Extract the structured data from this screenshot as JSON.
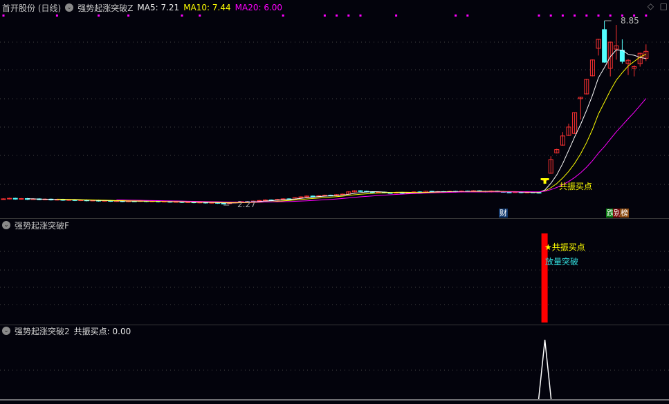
{
  "header": {
    "stock": "首开股份 (日线)",
    "indicator": "强势起涨突破Z",
    "ma5_label": "MA5: 7.21",
    "ma10_label": "MA10: 7.44",
    "ma20_label": "MA20: 6.00"
  },
  "colors": {
    "up": "#ff3232",
    "down": "#54ffff",
    "ma5": "#ffffff",
    "ma10": "#ffff00",
    "ma20": "#ff00ff",
    "signal": "#ff00ff"
  },
  "main": {
    "high_label": "8.85",
    "low_label": "2.27",
    "buy_label": "共振买点",
    "badges": {
      "finance": "财",
      "tag1": "跌",
      "tag2": "别",
      "tag3": "榜"
    }
  },
  "panel2": {
    "title": "强势起涨突破F",
    "star_label": "★共振买点",
    "vol_label": "放量突破"
  },
  "panel3": {
    "title": "强势起涨突破2",
    "value_label": "共振买点: 0.00"
  },
  "top_icons": {
    "diamond": "◇",
    "box": "□"
  },
  "chart_data": {
    "type": "candlestick",
    "price_range": [
      2.0,
      9.0
    ],
    "flat_closes": [
      2.45,
      2.47,
      2.44,
      2.46,
      2.43,
      2.45,
      2.42,
      2.44,
      2.41,
      2.43,
      2.4,
      2.42,
      2.39,
      2.41,
      2.38,
      2.4,
      2.37,
      2.39,
      2.36,
      2.38,
      2.35,
      2.37,
      2.36,
      2.38,
      2.35,
      2.37,
      2.34,
      2.36,
      2.33,
      2.35,
      2.32,
      2.34,
      2.31,
      2.33,
      2.3,
      2.32,
      2.29,
      2.28,
      2.31,
      2.33,
      2.35,
      2.34,
      2.37,
      2.39,
      2.41,
      2.4,
      2.43,
      2.45,
      2.44,
      2.5,
      2.52,
      2.55,
      2.53,
      2.56,
      2.58,
      2.57,
      2.6,
      2.62,
      2.7,
      2.74,
      2.72,
      2.7,
      2.68,
      2.69,
      2.67,
      2.66,
      2.68,
      2.65,
      2.67,
      2.7,
      2.68,
      2.72,
      2.7,
      2.71,
      2.69,
      2.72,
      2.7,
      2.73,
      2.71,
      2.74,
      2.72,
      2.7,
      2.73,
      2.71,
      2.69,
      2.68,
      2.7,
      2.67,
      2.69,
      2.68,
      2.66
    ],
    "rally_ohlc": [
      [
        3.12,
        3.14,
        3.16,
        3.1
      ],
      [
        3.37,
        3.86,
        3.98,
        3.35
      ],
      [
        4.1,
        4.22,
        4.25,
        4.08
      ],
      [
        4.38,
        4.71,
        4.85,
        4.36
      ],
      [
        4.73,
        5.03,
        5.15,
        4.71
      ],
      [
        4.8,
        5.55,
        5.56,
        4.78
      ],
      [
        6.05,
        6.1,
        6.12,
        5.3
      ],
      [
        6.22,
        6.74,
        6.76,
        6.2
      ],
      [
        6.87,
        7.44,
        7.46,
        6.85
      ],
      [
        7.86,
        8.18,
        8.2,
        7.6
      ],
      [
        8.53,
        7.36,
        8.85,
        7.34
      ],
      [
        7.14,
        8.08,
        8.1,
        6.85
      ],
      [
        7.83,
        7.95,
        8.7,
        7.45
      ],
      [
        7.79,
        7.39,
        8.18,
        7.31
      ],
      [
        7.31,
        7.43,
        7.47,
        6.9
      ],
      [
        7.14,
        7.2,
        7.25,
        6.85
      ],
      [
        7.3,
        7.68,
        7.7,
        7.2
      ],
      [
        7.5,
        7.75,
        8.0,
        7.4
      ]
    ],
    "signal_days": [
      0,
      9,
      16,
      21,
      30,
      33,
      47,
      54,
      56,
      58,
      60,
      66,
      76,
      78,
      90,
      92,
      94,
      96,
      98,
      100,
      102,
      104,
      106,
      108
    ],
    "buy_signal_index": 91,
    "panel2_value": 1,
    "panel3_value": 1
  }
}
